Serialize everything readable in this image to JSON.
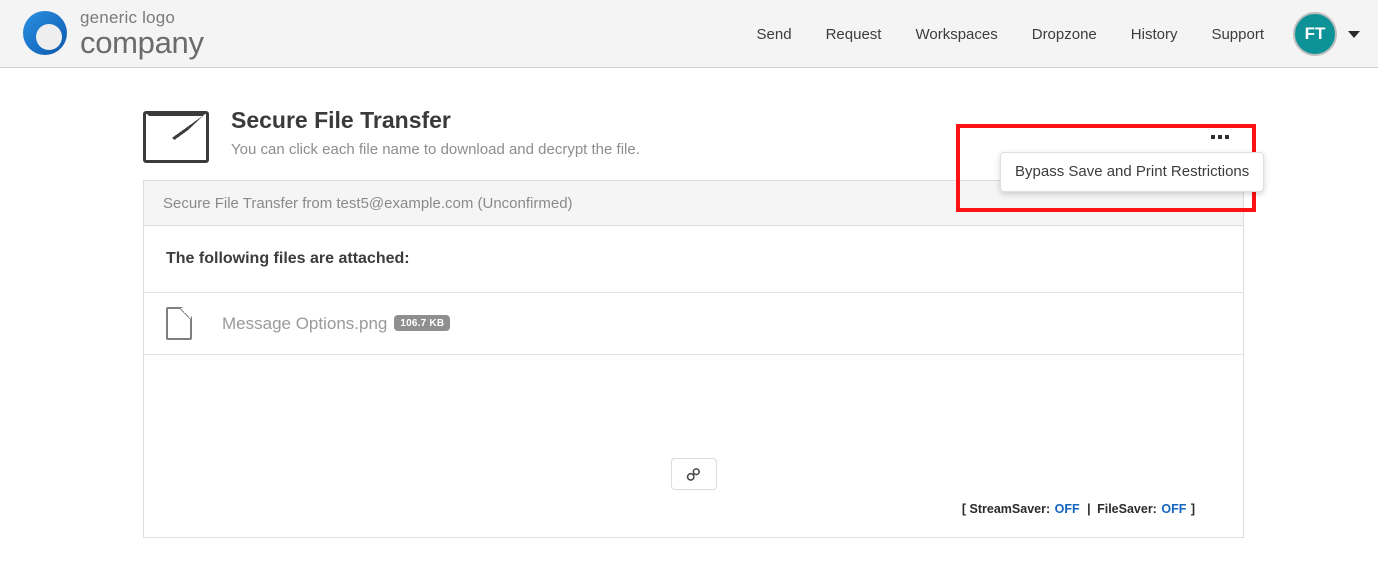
{
  "header": {
    "logo": {
      "line1": "generic logo",
      "line2": "company",
      "color": "#1a73c8"
    },
    "nav_items": [
      {
        "label": "Send"
      },
      {
        "label": "Request"
      },
      {
        "label": "Workspaces"
      },
      {
        "label": "Dropzone"
      },
      {
        "label": "History"
      },
      {
        "label": "Support"
      }
    ],
    "avatar": {
      "initials": "FT",
      "color": "#0d9298"
    }
  },
  "page": {
    "title": "Secure File Transfer",
    "subtitle": "You can click each file name to download and decrypt the file."
  },
  "panel": {
    "header": "Secure File Transfer from test5@example.com (Unconfirmed)",
    "attachments_heading": "The following files are attached:",
    "files": [
      {
        "name": "Message Options.png",
        "size": "106.7 KB"
      }
    ],
    "body_message": "",
    "status": {
      "open_bracket": "[",
      "stream_saver_label": "StreamSaver:",
      "stream_saver_value": "OFF",
      "separator": "|",
      "file_saver_label": "FileSaver:",
      "file_saver_value": "OFF",
      "close_bracket": "]",
      "value_color": "#1565c0"
    }
  },
  "options_menu": {
    "trigger_label": "•••",
    "items": [
      {
        "label": "Bypass Save and Print Restrictions"
      }
    ]
  },
  "annotation": {
    "color": "#fb1212"
  }
}
